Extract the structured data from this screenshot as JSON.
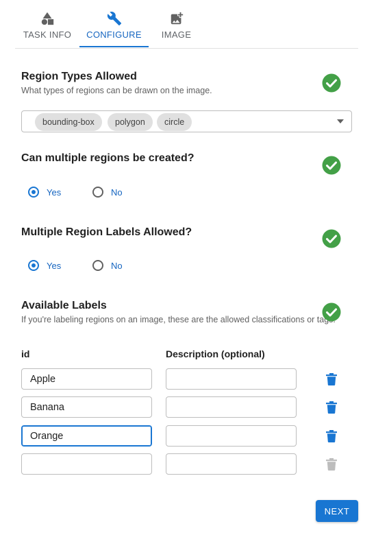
{
  "tabs": [
    {
      "label": "TASK INFO",
      "icon": "shapes-icon",
      "active": false
    },
    {
      "label": "CONFIGURE",
      "icon": "wrench-icon",
      "active": true
    },
    {
      "label": "IMAGE",
      "icon": "add-image-icon",
      "active": false
    }
  ],
  "region_types": {
    "title": "Region Types Allowed",
    "description": "What types of regions can be drawn on the image.",
    "selected": [
      "bounding-box",
      "polygon",
      "circle"
    ],
    "status_icon": "check-circle-icon"
  },
  "multiple_regions": {
    "title": "Can multiple regions be created?",
    "options": [
      "Yes",
      "No"
    ],
    "selected": "Yes",
    "status_icon": "check-circle-icon"
  },
  "multiple_labels": {
    "title": "Multiple Region Labels Allowed?",
    "options": [
      "Yes",
      "No"
    ],
    "selected": "Yes",
    "status_icon": "check-circle-icon"
  },
  "labels": {
    "title": "Available Labels",
    "description": "If you're labeling regions on an image, these are the allowed classifications or tags.",
    "columns": [
      "id",
      "Description (optional)"
    ],
    "rows": [
      {
        "id": "Apple",
        "description": ""
      },
      {
        "id": "Banana",
        "description": ""
      },
      {
        "id": "Orange",
        "description": ""
      },
      {
        "id": "",
        "description": ""
      }
    ],
    "status_icon": "check-circle-icon"
  },
  "footer": {
    "next_label": "NEXT"
  },
  "colors": {
    "primary": "#1976d2",
    "success": "#43a047",
    "delete_active": "#1976d2",
    "delete_disabled": "#bdbdbd"
  }
}
